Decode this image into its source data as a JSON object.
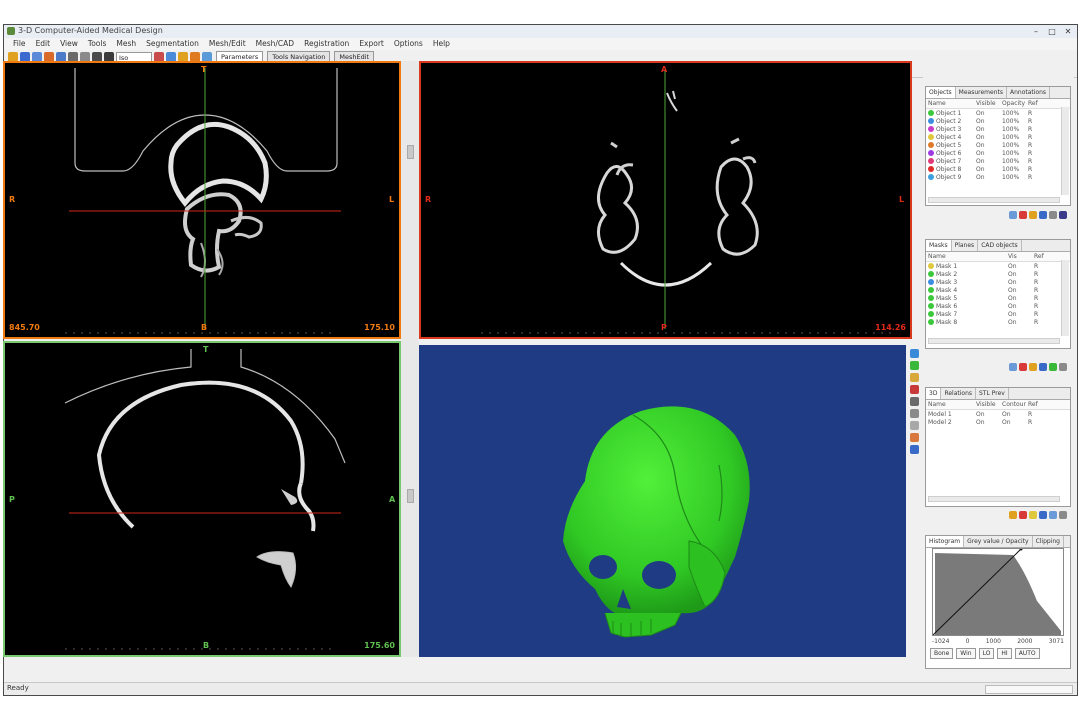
{
  "window": {
    "title": "3-D Computer-Aided Medical Design",
    "minimize": "–",
    "maximize": "□",
    "close": "✕"
  },
  "menu": [
    "File",
    "Edit",
    "View",
    "Tools",
    "Mesh",
    "Segmentation",
    "Mesh/Edit",
    "Mesh/CAD",
    "Registration",
    "Export",
    "Options",
    "Help"
  ],
  "toolbar": {
    "combo_value": "Iso",
    "tabs": [
      "Parameters",
      "Tools Navigation",
      "MeshEdit"
    ]
  },
  "views": {
    "axial": {
      "top": "T",
      "left": "R",
      "right": "L",
      "bottom": "B",
      "value_left": "845.70",
      "value_right": "175.10",
      "border": "#f07a10"
    },
    "coronal": {
      "top": "A",
      "left": "R",
      "right": "L",
      "bottom": "P",
      "value_right": "114.26",
      "border": "#d8381c"
    },
    "sagittal": {
      "top": "T",
      "left": "P",
      "right": "A",
      "bottom": "B",
      "value_right": "175.60",
      "border": "#78c870"
    },
    "render3d": {
      "background": "#1f3b84",
      "mesh_color": "#35d82a"
    }
  },
  "panels": {
    "objects": {
      "tabs": [
        "Objects",
        "Measurements",
        "Annotations"
      ],
      "columns": [
        "Name",
        "Visible",
        "Opacity",
        "Ref"
      ],
      "rows": [
        {
          "name": "Object 1",
          "color": "#3cc83c",
          "v": "On",
          "o": "100%",
          "r": "R"
        },
        {
          "name": "Object 2",
          "color": "#3c8ce0",
          "v": "On",
          "o": "100%",
          "r": "R"
        },
        {
          "name": "Object 3",
          "color": "#c83cc8",
          "v": "On",
          "o": "100%",
          "r": "R"
        },
        {
          "name": "Object 4",
          "color": "#e0c83c",
          "v": "On",
          "o": "100%",
          "r": "R"
        },
        {
          "name": "Object 5",
          "color": "#e07a2a",
          "v": "On",
          "o": "100%",
          "r": "R"
        },
        {
          "name": "Object 6",
          "color": "#9c3ce0",
          "v": "On",
          "o": "100%",
          "r": "R"
        },
        {
          "name": "Object 7",
          "color": "#e03c7a",
          "v": "On",
          "o": "100%",
          "r": "R"
        },
        {
          "name": "Object 8",
          "color": "#e02a2a",
          "v": "On",
          "o": "100%",
          "r": "R"
        },
        {
          "name": "Object 9",
          "color": "#3ca0e0",
          "v": "On",
          "o": "100%",
          "r": "R"
        }
      ]
    },
    "masks": {
      "tabs": [
        "Masks",
        "Planes",
        "CAD objects"
      ],
      "columns": [
        "Name",
        "Vis",
        "Ref"
      ],
      "rows": [
        {
          "name": "Mask 1",
          "color": "#e0c83c",
          "v": "On",
          "r": "R"
        },
        {
          "name": "Mask 2",
          "color": "#3cc83c",
          "v": "On",
          "r": "R"
        },
        {
          "name": "Mask 3",
          "color": "#3c8ce0",
          "v": "On",
          "r": "R"
        },
        {
          "name": "Mask 4",
          "color": "#3cc83c",
          "v": "On",
          "r": "R"
        },
        {
          "name": "Mask 5",
          "color": "#3cc83c",
          "v": "On",
          "r": "R"
        },
        {
          "name": "Mask 6",
          "color": "#3cc83c",
          "v": "On",
          "r": "R"
        },
        {
          "name": "Mask 7",
          "color": "#3cc83c",
          "v": "On",
          "r": "R"
        },
        {
          "name": "Mask 8",
          "color": "#3cc83c",
          "v": "On",
          "r": "R"
        }
      ]
    },
    "meshes": {
      "tabs": [
        "3D",
        "Relations",
        "STL Prev"
      ],
      "columns": [
        "Name",
        "Visible",
        "Contour",
        "Ref"
      ],
      "rows": [
        {
          "name": "Model 1",
          "v": "On",
          "c": "On",
          "r": "R"
        },
        {
          "name": "Model 2",
          "v": "On",
          "c": "On",
          "r": "R"
        }
      ]
    },
    "histogram": {
      "tabs": [
        "Histogram",
        "Grey value / Opacity",
        "Clipping"
      ],
      "ticks": [
        "-1024",
        "0",
        "1000",
        "2000",
        "3071"
      ],
      "mode_value": "Bone",
      "buttons": [
        "Win",
        "LO",
        "HI",
        "AUTO"
      ]
    }
  },
  "status": {
    "text": "Ready"
  }
}
